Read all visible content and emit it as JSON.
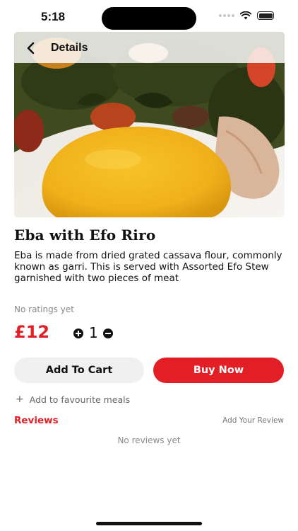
{
  "status_bar": {
    "time": "5:18"
  },
  "header": {
    "title": "Details",
    "back_icon": "chevron-left-icon"
  },
  "hero": {
    "image_subject": "eba-with-efo-riro-food-photo"
  },
  "dish": {
    "title": "Eba with Efo Riro",
    "description": "Eba is made from dried grated cassava flour, commonly known as garri. This is served with Assorted Efo Stew garnished with two pieces of meat",
    "ratings_text": "No ratings yet",
    "price": "£12",
    "quantity": "1"
  },
  "actions": {
    "add_to_cart": "Add To Cart",
    "buy_now": "Buy Now",
    "add_favourite": "Add to favourite meals"
  },
  "reviews": {
    "heading": "Reviews",
    "add_review": "Add Your Review",
    "empty_text": "No reviews yet"
  },
  "colors": {
    "accent": "#e21f26",
    "muted_text": "#8a8a8a",
    "cart_button_bg": "#f0f0f0"
  }
}
